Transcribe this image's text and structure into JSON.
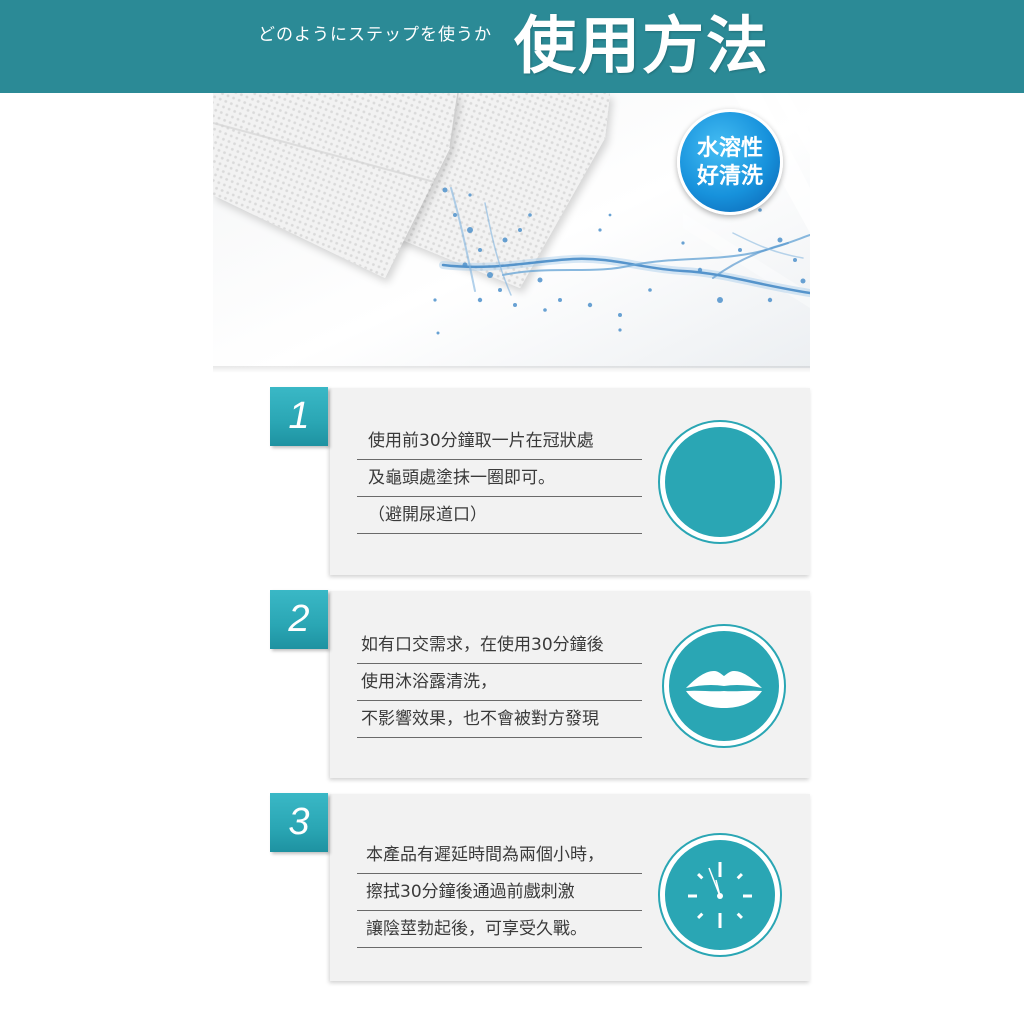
{
  "header": {
    "subtitle": "どのようにステップを使うか",
    "title": "使用方法"
  },
  "hero": {
    "badge_lines": [
      "水溶性",
      "好清洗"
    ]
  },
  "steps": [
    {
      "number": "1",
      "lines": [
        "使用前30分鐘取一片在冠狀處",
        "及龜頭處塗抹一圈即可。",
        "（避開尿道口）"
      ],
      "icon": "blank-circle-icon"
    },
    {
      "number": "2",
      "lines": [
        "如有口交需求，在使用30分鐘後",
        "使用沐浴露清洗，",
        "不影響效果，也不會被對方發現"
      ],
      "icon": "lips-icon"
    },
    {
      "number": "3",
      "lines": [
        "本產品有遲延時間為兩個小時，",
        "擦拭30分鐘後通過前戲刺激",
        "讓陰莖勃起後，可享受久戰。"
      ],
      "icon": "clock-icon"
    }
  ],
  "colors": {
    "header": "#2b8a96",
    "accent": "#2aa6b4",
    "panel": "#f2f2f2",
    "text": "#3a3a3a",
    "badge": "#1792dc",
    "water": "#3f86c4"
  }
}
